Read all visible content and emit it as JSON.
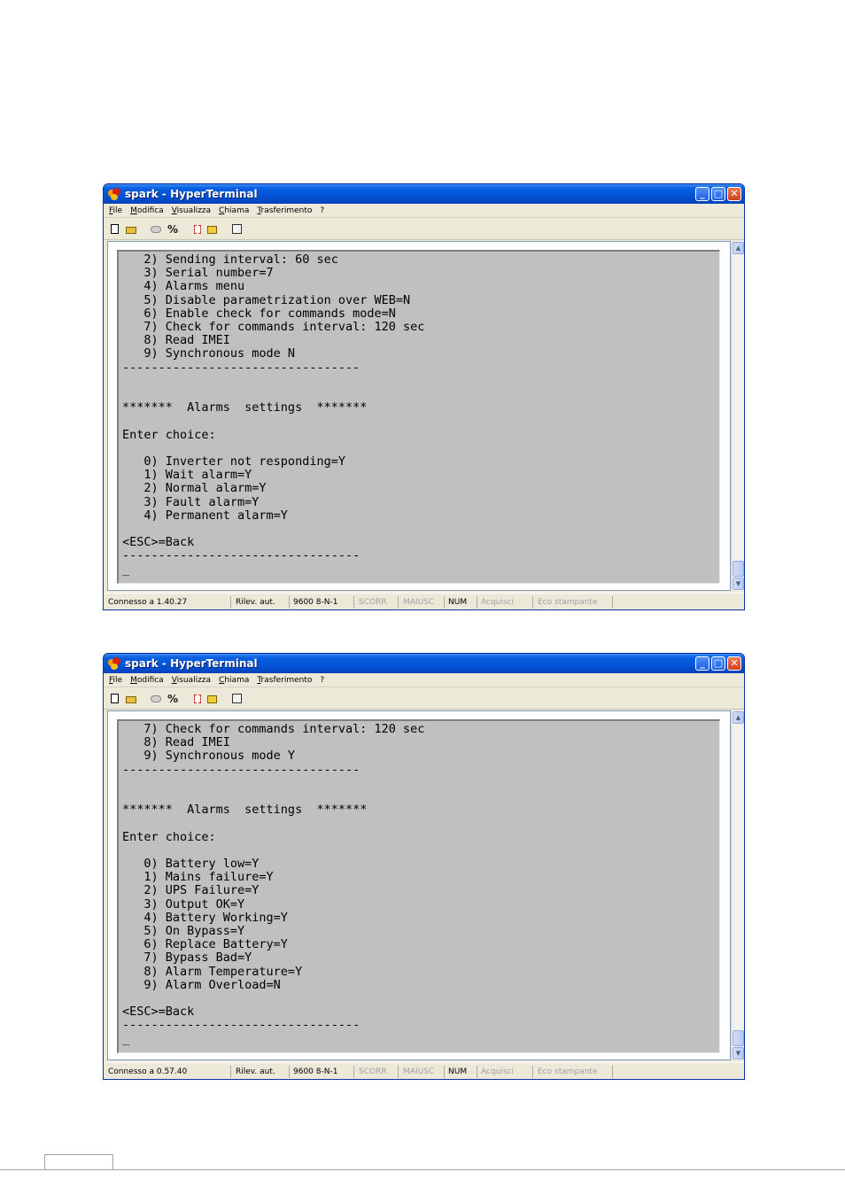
{
  "windows": [
    {
      "title": "spark - HyperTerminal",
      "menu": [
        "File",
        "Modifica",
        "Visualizza",
        "Chiama",
        "Trasferimento",
        "?"
      ],
      "terminal_text": "   2) Sending interval: 60 sec\n   3) Serial number=7\n   4) Alarms menu\n   5) Disable parametrization over WEB=N\n   6) Enable check for commands mode=N\n   7) Check for commands interval: 120 sec\n   8) Read IMEI\n   9) Synchronous mode N\n---------------------------------\n\n\n*******  Alarms  settings  *******\n\nEnter choice:\n\n   0) Inverter not responding=Y\n   1) Wait alarm=Y\n   2) Normal alarm=Y\n   3) Fault alarm=Y\n   4) Permanent alarm=Y\n\n<ESC>=Back\n---------------------------------\n_",
      "status": {
        "connected": "Connesso a 1.40.27",
        "detect": "Rilev. aut.",
        "port": "9600 8-N-1",
        "scroll": "SCORR",
        "caps": "MAIUSC",
        "num": "NUM",
        "capture": "Acquisci",
        "echo": "Eco stampante"
      }
    },
    {
      "title": "spark - HyperTerminal",
      "menu": [
        "File",
        "Modifica",
        "Visualizza",
        "Chiama",
        "Trasferimento",
        "?"
      ],
      "terminal_text": "   7) Check for commands interval: 120 sec\n   8) Read IMEI\n   9) Synchronous mode Y\n---------------------------------\n\n\n*******  Alarms  settings  *******\n\nEnter choice:\n\n   0) Battery low=Y\n   1) Mains failure=Y\n   2) UPS Failure=Y\n   3) Output OK=Y\n   4) Battery Working=Y\n   5) On Bypass=Y\n   6) Replace Battery=Y\n   7) Bypass Bad=Y\n   8) Alarm Temperature=Y\n   9) Alarm Overload=N\n\n<ESC>=Back\n---------------------------------\n_",
      "status": {
        "connected": "Connesso a 0.57.40",
        "detect": "Rilev. aut.",
        "port": "9600 8-N-1",
        "scroll": "SCORR",
        "caps": "MAIUSC",
        "num": "NUM",
        "capture": "Acquisci",
        "echo": "Eco stampante"
      }
    }
  ],
  "icons": {
    "app": "hyperterminal-icon",
    "minimize": "minimize-icon",
    "maximize": "maximize-icon",
    "close": "close-icon",
    "scroll_up": "scroll-up-icon",
    "scroll_down": "scroll-down-icon"
  },
  "colors": {
    "titlebar": "#0554d8",
    "terminal_bg": "#c0c0c0",
    "terminal_text": "#000000",
    "window_bg": "#ece9d8"
  }
}
